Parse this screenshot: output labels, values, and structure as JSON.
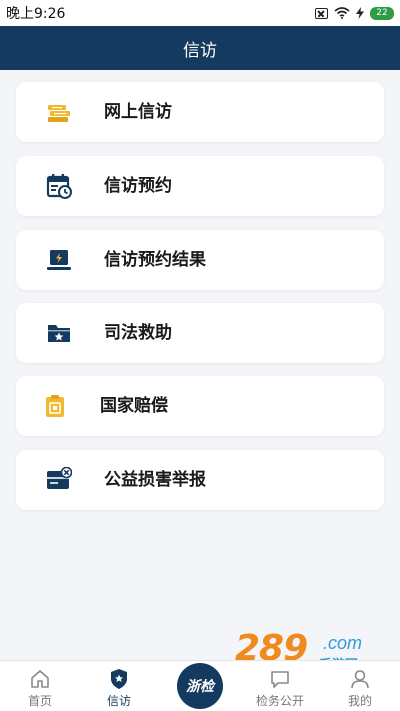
{
  "status_bar": {
    "time": "晚上9:26",
    "battery": "22"
  },
  "header": {
    "title": "信访"
  },
  "menu": [
    {
      "label": "网上信访",
      "icon": "books-icon"
    },
    {
      "label": "信访预约",
      "icon": "calendar-clock-icon"
    },
    {
      "label": "信访预约结果",
      "icon": "laptop-result-icon"
    },
    {
      "label": "司法救助",
      "icon": "folder-star-icon"
    },
    {
      "label": "国家赔偿",
      "icon": "clipboard-icon"
    },
    {
      "label": "公益损害举报",
      "icon": "card-alert-icon"
    }
  ],
  "bottom_nav": {
    "home": "首页",
    "petition": "信访",
    "center": "浙检",
    "public": "检务公开",
    "mine": "我的"
  },
  "watermark": {
    "number": "289",
    "domain": ".com",
    "sub": "手游网"
  },
  "colors": {
    "primary": "#153a5f",
    "accent_yellow": "#f2b82e",
    "background": "#f3f5f8"
  }
}
